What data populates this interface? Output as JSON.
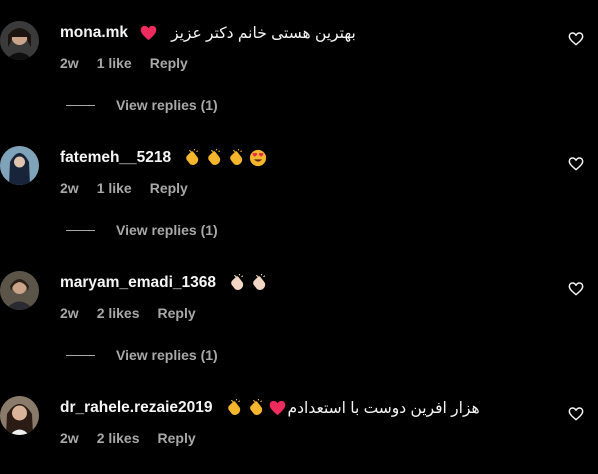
{
  "colors": {
    "background": "#000000",
    "primary_text": "#f5f5f5",
    "secondary_text": "#a8a8a8",
    "emoji_heart": "#f02b5e",
    "emoji_clap": "#f5b52c"
  },
  "icons": {
    "like": "heart-outline-icon"
  },
  "comments": [
    {
      "username": "mona.mk",
      "text": "بهترین هستی خانم دکتر عزیز",
      "emojis": [
        "pink-heart"
      ],
      "time": "2w",
      "likes": "1 like",
      "reply_label": "Reply",
      "view_replies": "View replies (1)"
    },
    {
      "username": "fatemeh__5218",
      "text": "",
      "emojis": [
        "clap",
        "clap",
        "clap",
        "heart-eyes"
      ],
      "time": "2w",
      "likes": "1 like",
      "reply_label": "Reply",
      "view_replies": "View replies (1)"
    },
    {
      "username": "maryam_emadi_1368",
      "text": "",
      "emojis": [
        "clap-light",
        "clap-light"
      ],
      "time": "2w",
      "likes": "2 likes",
      "reply_label": "Reply",
      "view_replies": "View replies (1)"
    },
    {
      "username": "dr_rahele.rezaie2019",
      "text": "هزار افرین دوست با استعدادم",
      "emojis_before_text": [
        "clap",
        "clap",
        "pink-heart"
      ],
      "time": "2w",
      "likes": "2 likes",
      "reply_label": "Reply"
    }
  ]
}
